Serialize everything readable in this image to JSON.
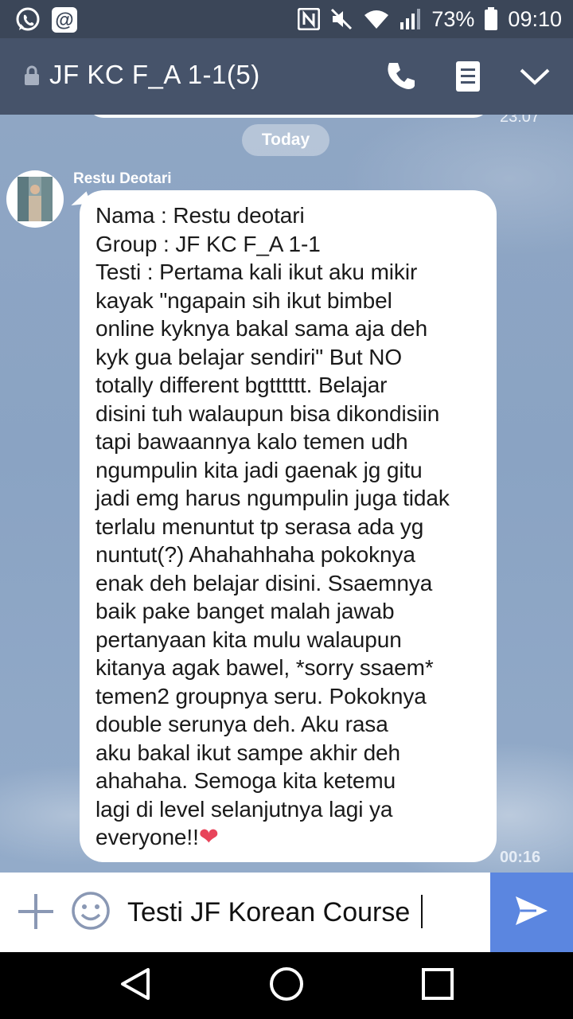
{
  "status_bar": {
    "battery": "73%",
    "time": "09:10",
    "apps": [
      "whatsapp-icon",
      "mention-icon"
    ],
    "icons": [
      "nfc-icon",
      "mute-icon",
      "wifi-icon",
      "signal-icon",
      "battery-icon"
    ]
  },
  "header": {
    "title": "JF KC F_A 1-1(5)",
    "icons": [
      "lock-icon",
      "phone-icon",
      "notes-icon",
      "chevron-down-icon"
    ]
  },
  "chat": {
    "date_divider": "Today",
    "prev_time": "23:07",
    "message": {
      "sender": "Restu Deotari",
      "text": "Nama : Restu deotari\nGroup : JF KC F_A 1-1\nTesti : Pertama kali ikut aku mikir\nkayak \"ngapain sih ikut bimbel\nonline kyknya bakal sama aja deh\nkyk gua belajar sendiri\" But NO\ntotally different bgtttttt. Belajar\ndisini tuh walaupun bisa dikondisiin\ntapi bawaannya kalo temen udh\nngumpulin kita jadi gaenak jg gitu\njadi emg harus ngumpulin juga tidak\nterlalu menuntut tp serasa ada yg\nnuntut(?) Ahahahhaha pokoknya\nenak deh belajar disini. Ssaemnya\nbaik pake banget malah jawab\npertanyaan kita mulu walaupun\nkitanya agak bawel, *sorry ssaem*\ntemen2 groupnya seru. Pokoknya\ndouble serunya deh. Aku rasa\naku bakal ikut sampe akhir deh\nahahaha. Semoga kita ketemu\nlagi di level selanjutnya lagi ya\neveryone!!",
      "emoji": "❤",
      "time": "00:16"
    }
  },
  "input": {
    "value": "Testi JF Korean Course",
    "icons": [
      "plus-icon",
      "emoji-icon",
      "send-icon"
    ]
  },
  "nav": {
    "icons": [
      "back-icon",
      "home-icon",
      "recents-icon"
    ]
  },
  "colors": {
    "header": "#46536a",
    "status_bar": "#3b4658",
    "chat_background": "#8fa6c4",
    "send_button": "#5b86e0",
    "heart": "#e8445a"
  }
}
